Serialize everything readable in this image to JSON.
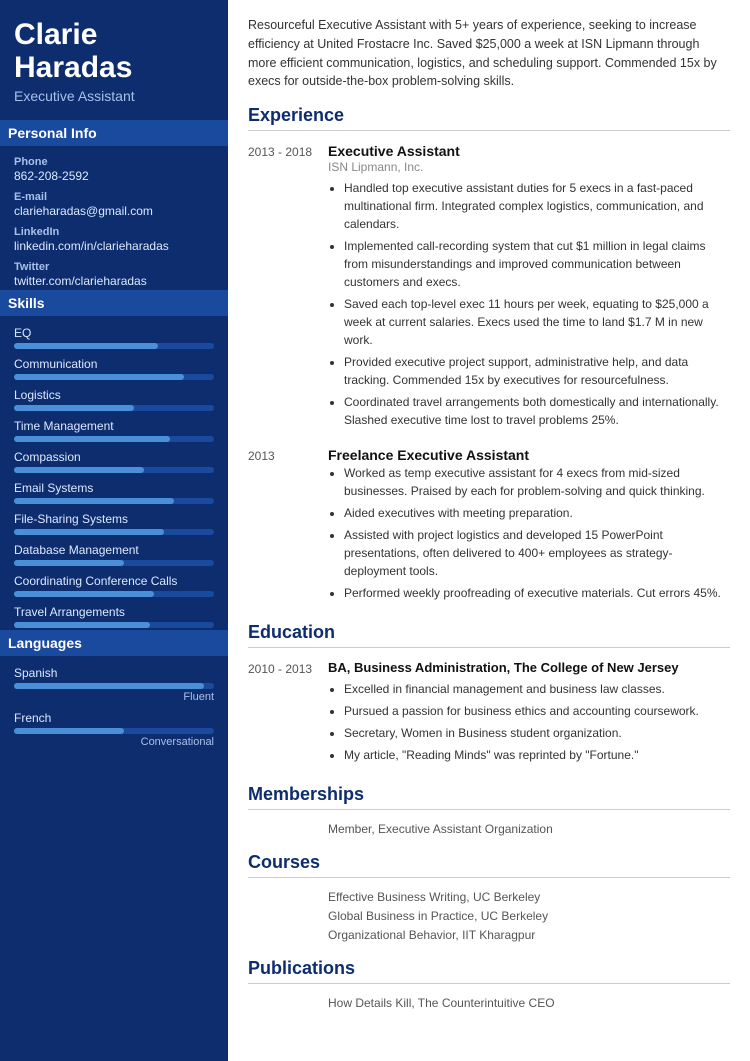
{
  "sidebar": {
    "name_line1": "Clarie",
    "name_line2": "Haradas",
    "title": "Executive Assistant",
    "personal_info_heading": "Personal Info",
    "phone_label": "Phone",
    "phone_value": "862-208-2592",
    "email_label": "E-mail",
    "email_value": "clarieharadas@gmail.com",
    "linkedin_label": "LinkedIn",
    "linkedin_value": "linkedin.com/in/clarieharadas",
    "twitter_label": "Twitter",
    "twitter_value": "twitter.com/clarieharadas",
    "skills_heading": "Skills",
    "skills": [
      {
        "name": "EQ",
        "pct": 72
      },
      {
        "name": "Communication",
        "pct": 85
      },
      {
        "name": "Logistics",
        "pct": 60
      },
      {
        "name": "Time Management",
        "pct": 78
      },
      {
        "name": "Compassion",
        "pct": 65
      },
      {
        "name": "Email Systems",
        "pct": 80
      },
      {
        "name": "File-Sharing Systems",
        "pct": 75
      },
      {
        "name": "Database Management",
        "pct": 55
      },
      {
        "name": "Coordinating Conference Calls",
        "pct": 70
      },
      {
        "name": "Travel Arrangements",
        "pct": 68
      }
    ],
    "languages_heading": "Languages",
    "languages": [
      {
        "name": "Spanish",
        "pct": 95,
        "level": "Fluent"
      },
      {
        "name": "French",
        "pct": 55,
        "level": "Conversational"
      }
    ]
  },
  "main": {
    "summary": "Resourceful Executive Assistant with 5+ years of experience, seeking to increase efficiency at United Frostacre Inc. Saved $25,000 a week at ISN Lipmann through more efficient communication, logistics, and scheduling support. Commended 15x by execs for outside-the-box problem-solving skills.",
    "experience_heading": "Experience",
    "experience": [
      {
        "dates": "2013 - 2018",
        "title": "Executive Assistant",
        "company": "ISN Lipmann, Inc.",
        "bullets": [
          "Handled top executive assistant duties for 5 execs in a fast-paced multinational firm. Integrated complex logistics, communication, and calendars.",
          "Implemented call-recording system that cut $1 million in legal claims from misunderstandings and improved communication between customers and execs.",
          "Saved each top-level exec 11 hours per week, equating to $25,000 a week at current salaries. Execs used the time to land $1.7 M in new work.",
          "Provided executive project support, administrative help, and data tracking. Commended 15x by executives for resourcefulness.",
          "Coordinated travel arrangements both domestically and internationally. Slashed executive time lost to travel problems 25%."
        ]
      },
      {
        "dates": "2013",
        "title": "Freelance Executive Assistant",
        "company": "",
        "bullets": [
          "Worked as temp executive assistant for 4 execs from mid-sized businesses. Praised by each for problem-solving and quick thinking.",
          "Aided executives with meeting preparation.",
          "Assisted with project logistics and developed 15 PowerPoint presentations, often delivered to 400+ employees as strategy-deployment tools.",
          "Performed weekly proofreading of executive materials. Cut errors 45%."
        ]
      }
    ],
    "education_heading": "Education",
    "education": [
      {
        "dates": "2010 - 2013",
        "degree": "BA, Business Administration, The College of New Jersey",
        "bullets": [
          "Excelled in financial management and business law classes.",
          "Pursued a passion for business ethics and accounting coursework.",
          "Secretary, Women in Business student organization.",
          "My article, \"Reading Minds\" was reprinted by \"Fortune.\""
        ]
      }
    ],
    "memberships_heading": "Memberships",
    "memberships": [
      "Member, Executive Assistant Organization"
    ],
    "courses_heading": "Courses",
    "courses": [
      "Effective Business Writing, UC Berkeley",
      "Global Business in Practice, UC Berkeley",
      "Organizational Behavior, IIT Kharagpur"
    ],
    "publications_heading": "Publications",
    "publications": [
      "How Details Kill, The Counterintuitive CEO"
    ]
  }
}
